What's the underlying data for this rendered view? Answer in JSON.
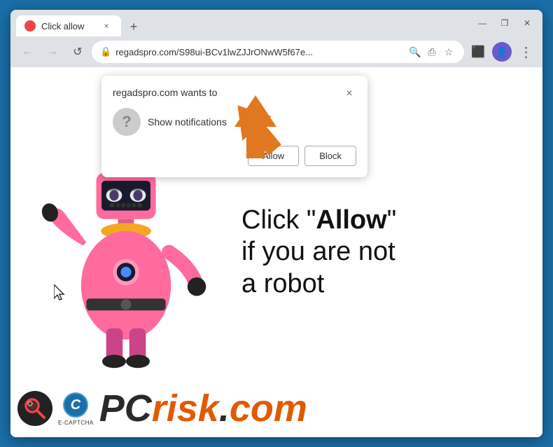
{
  "browser": {
    "tab": {
      "favicon_color": "#e44444",
      "title": "Click allow",
      "close_label": "×"
    },
    "new_tab_label": "+",
    "window_controls": {
      "minimize": "—",
      "maximize": "❐",
      "close": "✕"
    },
    "toolbar": {
      "back_label": "←",
      "forward_label": "→",
      "reload_label": "↺",
      "url": "regadspro.com/S98ui-BCv1lwZJJrONwW5f67e...",
      "search_label": "🔍",
      "share_label": "⎙",
      "bookmark_label": "☆",
      "extensions_label": "⬛",
      "profile_label": "👤",
      "menu_label": "⋮"
    },
    "notification_popup": {
      "title": "regadspro.com wants to",
      "close_label": "×",
      "message": "Show notifications",
      "allow_label": "Allow",
      "block_label": "Block"
    }
  },
  "page": {
    "main_text_line1": "Click \"",
    "main_text_allow": "Allow",
    "main_text_line1_end": "\"",
    "main_text_line2": "if you are not",
    "main_text_line3": "a robot"
  },
  "footer": {
    "pcrisk": "PCrisk.com",
    "captcha_label": "E-CAPTCHA"
  },
  "icons": {
    "lock": "🔒",
    "question_mark": "?"
  }
}
